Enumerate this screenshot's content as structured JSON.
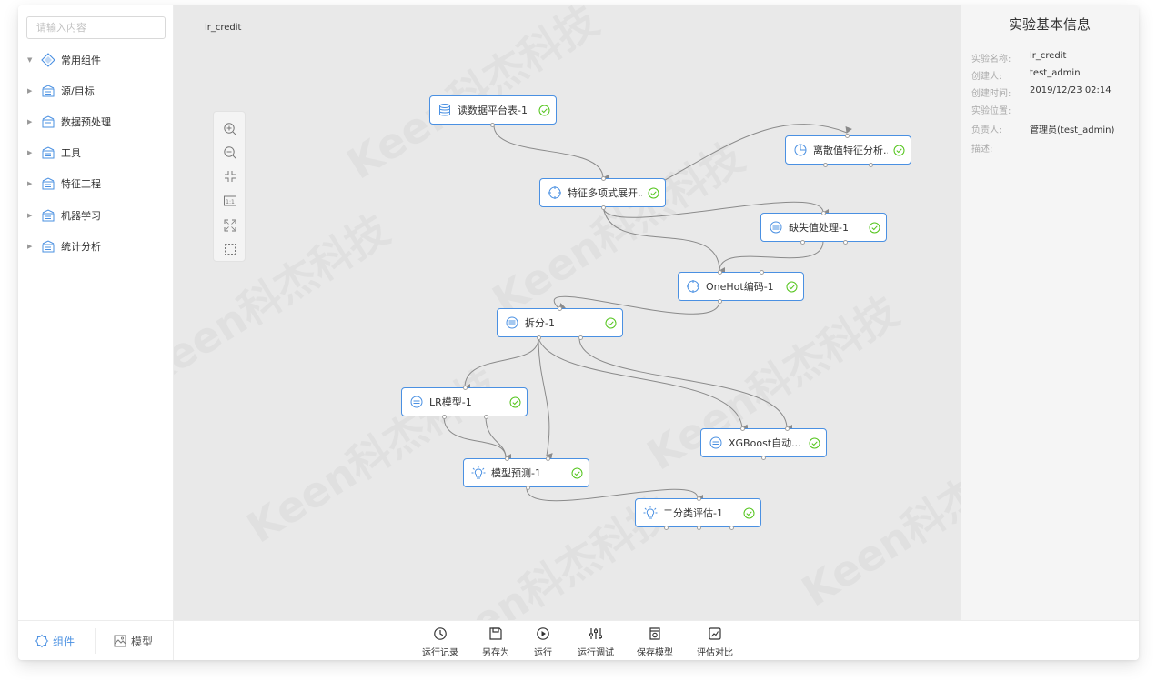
{
  "search": {
    "placeholder": "请输入内容"
  },
  "sidebar": {
    "items": [
      {
        "label": "常用组件",
        "expanded": true,
        "icon": "diamond-stack-icon"
      },
      {
        "label": "源/目标",
        "expanded": false,
        "icon": "folder-stack-icon"
      },
      {
        "label": "数据预处理",
        "expanded": false,
        "icon": "folder-stack-icon"
      },
      {
        "label": "工具",
        "expanded": false,
        "icon": "folder-stack-icon"
      },
      {
        "label": "特征工程",
        "expanded": false,
        "icon": "folder-stack-icon"
      },
      {
        "label": "机器学习",
        "expanded": false,
        "icon": "folder-stack-icon"
      },
      {
        "label": "统计分析",
        "expanded": false,
        "icon": "folder-stack-icon"
      }
    ]
  },
  "canvas": {
    "experiment_label": "lr_credit",
    "watermark": "Keen科杰科技",
    "zoom_tools": [
      "zoom-in-icon",
      "zoom-out-icon",
      "shrink-icon",
      "actual-size-icon",
      "fit-screen-icon",
      "select-area-icon"
    ],
    "nodes": [
      {
        "label": "读数据平台表-1",
        "icon": "database-icon",
        "status": "success"
      },
      {
        "label": "离散值特征分析...",
        "icon": "pie-chart-icon",
        "status": "success"
      },
      {
        "label": "特征多项式展开...",
        "icon": "crosshair-icon",
        "status": "success"
      },
      {
        "label": "缺失值处理-1",
        "icon": "filter-icon",
        "status": "success"
      },
      {
        "label": "OneHot编码-1",
        "icon": "crosshair-icon",
        "status": "success"
      },
      {
        "label": "拆分-1",
        "icon": "filter-icon",
        "status": "success"
      },
      {
        "label": "LR模型-1",
        "icon": "model-icon",
        "status": "success"
      },
      {
        "label": "XGBoost自动...",
        "icon": "model-icon",
        "status": "success"
      },
      {
        "label": "模型预测-1",
        "icon": "bulb-icon",
        "status": "success"
      },
      {
        "label": "二分类评估-1",
        "icon": "bulb-icon",
        "status": "success"
      }
    ]
  },
  "info": {
    "title": "实验基本信息",
    "rows": [
      {
        "key": "实验名称:",
        "value": "lr_credit"
      },
      {
        "key": "创建人:",
        "value": "test_admin"
      },
      {
        "key": "创建时间:",
        "value": "2019/12/23 02:14"
      },
      {
        "key": "实验位置:",
        "value": ""
      },
      {
        "key": "负责人:",
        "value": "管理员(test_admin)"
      },
      {
        "key": "描述:",
        "value": ""
      }
    ]
  },
  "bottom": {
    "tabs": [
      {
        "label": "组件",
        "active": true,
        "icon": "component-icon"
      },
      {
        "label": "模型",
        "active": false,
        "icon": "model-image-icon"
      }
    ],
    "tools": [
      {
        "label": "运行记录",
        "icon": "clock-icon"
      },
      {
        "label": "另存为",
        "icon": "save-as-icon"
      },
      {
        "label": "运行",
        "icon": "play-icon"
      },
      {
        "label": "运行调试",
        "icon": "debug-sliders-icon"
      },
      {
        "label": "保存模型",
        "icon": "save-model-icon"
      },
      {
        "label": "评估对比",
        "icon": "compare-chart-icon"
      }
    ]
  },
  "colors": {
    "accent": "#4a90e2",
    "success": "#52c41a",
    "canvas_bg": "#e9e9e9",
    "edge": "#8a8a8a"
  }
}
